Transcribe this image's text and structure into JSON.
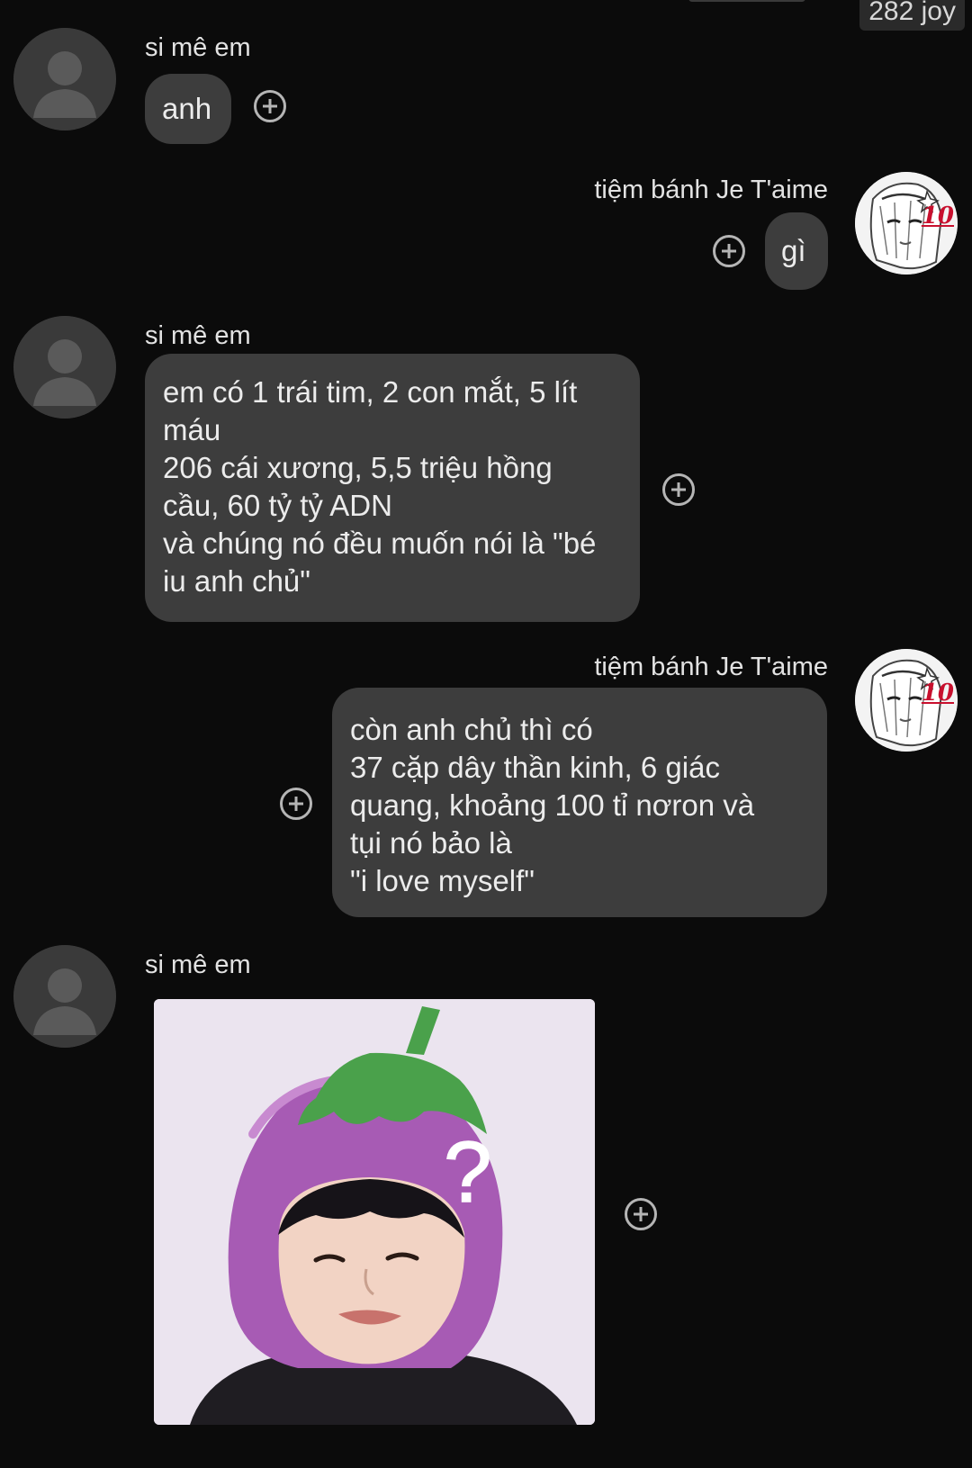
{
  "header": {
    "badge_text": "282 joy"
  },
  "contacts": {
    "other": "si mê em",
    "me": "tiệm bánh Je T'aime",
    "my_avatar_badge": "10"
  },
  "messages": [
    {
      "sender": "si mê em",
      "lines": [
        "anh"
      ]
    },
    {
      "sender": "tiệm bánh Je T'aime",
      "lines": [
        "gì"
      ]
    },
    {
      "sender": "si mê em",
      "lines": [
        "em có 1 trái tim, 2 con mắt, 5 lít",
        "máu",
        "206 cái xương, 5,5 triệu hồng",
        "cầu, 60 tỷ tỷ ADN",
        "và chúng nó đều muốn nói là \"bé",
        "iu anh chủ\""
      ]
    },
    {
      "sender": "tiệm bánh Je T'aime",
      "lines": [
        "còn anh chủ thì có",
        "37 cặp dây thần kinh, 6 giác",
        "quang, khoảng 100 tỉ nơron và",
        "tụi nó bảo là",
        "\"i love myself\""
      ]
    },
    {
      "sender": "si mê em",
      "sticker": "eggplant-hat-question",
      "sticker_text": "?"
    }
  ],
  "colors": {
    "background": "#0b0b0b",
    "bubble": "#3d3d3d",
    "text": "#ececec",
    "react_icon": "#b5b5b5",
    "badge_red": "#c8102e"
  },
  "icons": {
    "react": "add-reaction-icon",
    "default_avatar": "person-silhouette-icon"
  }
}
